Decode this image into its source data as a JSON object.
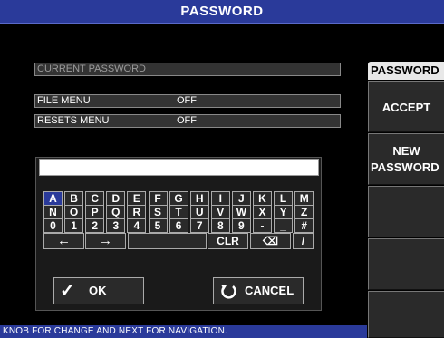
{
  "title": "PASSWORD",
  "fields": {
    "current_password": {
      "label": "CURRENT PASSWORD"
    },
    "file_menu": {
      "label": "FILE MENU",
      "value": "OFF"
    },
    "resets_menu": {
      "label": "RESETS MENU",
      "value": "OFF"
    }
  },
  "keyboard": {
    "input_value": "",
    "row1": [
      "A",
      "B",
      "C",
      "D",
      "E",
      "F",
      "G",
      "H",
      "I",
      "J",
      "K",
      "L",
      "M"
    ],
    "row2": [
      "N",
      "O",
      "P",
      "Q",
      "R",
      "S",
      "T",
      "U",
      "V",
      "W",
      "X",
      "Y",
      "Z"
    ],
    "row3": [
      "0",
      "1",
      "2",
      "3",
      "4",
      "5",
      "6",
      "7",
      "8",
      "9",
      "-",
      "_",
      "#"
    ],
    "row4": {
      "left": "←",
      "right": "→",
      "clr": "CLR",
      "backspace": "⌫",
      "slash": "/"
    },
    "ok_label": "OK",
    "cancel_label": "CANCEL",
    "selected_key": "A"
  },
  "sidebar": {
    "header": "PASSWORD",
    "accept": "ACCEPT",
    "new_password_line1": "NEW",
    "new_password_line2": "PASSWORD"
  },
  "status": "KNOB FOR CHANGE AND NEXT FOR NAVIGATION.",
  "colors": {
    "title_bg": "#2a3a9a",
    "key_selected": "#2a3a9a",
    "key_bg": "#2a2a2a"
  }
}
